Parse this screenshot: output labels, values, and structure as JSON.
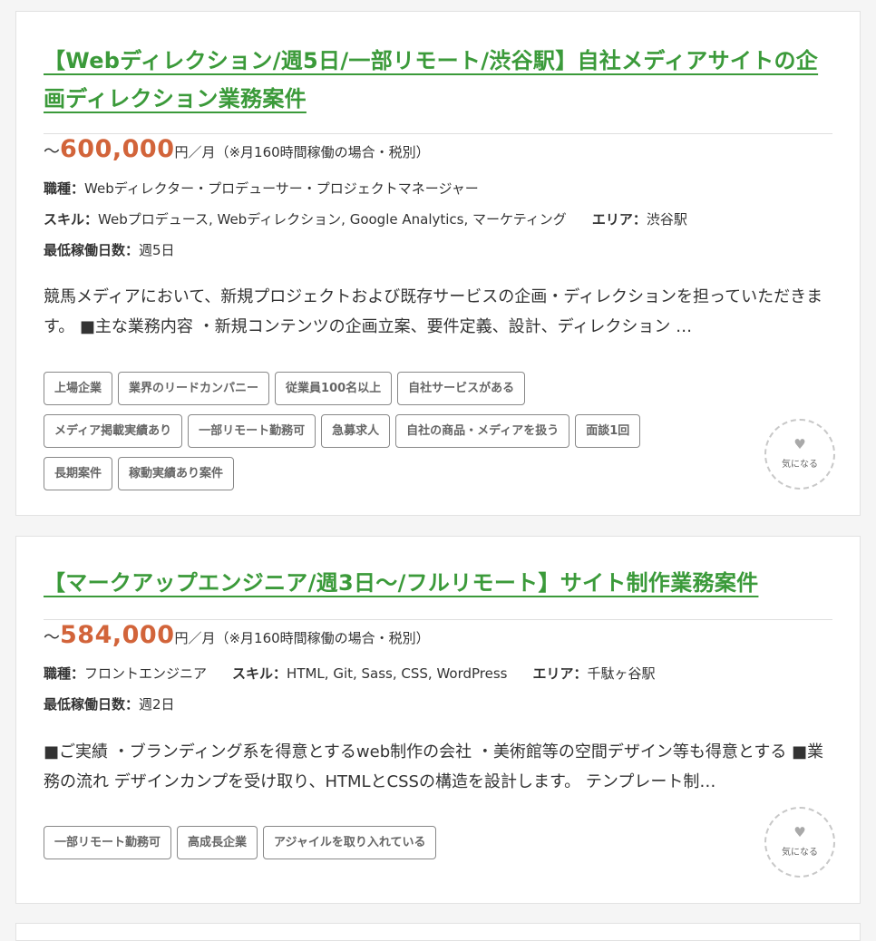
{
  "jobs": [
    {
      "title": "【Webディレクション/週5日/一部リモート/渋谷駅】自社メディアサイトの企画ディレクション業務案件",
      "tilde": "～",
      "price": "600,000",
      "unit": "円／月（※月160時間稼働の場合・税別）",
      "job_type_label": "職種：",
      "job_type": "Webディレクター・プロデューサー・プロジェクトマネージャー",
      "skill_label": "スキル：",
      "skills": "Webプロデュース, Webディレクション, Google Analytics, マーケティング",
      "area_label": "エリア：",
      "area": "渋谷駅",
      "min_days_label": "最低稼働日数：",
      "min_days": "週5日",
      "description": "競馬メディアにおいて、新規プロジェクトおよび既存サービスの企画・ディレクションを担っていただきます。 ■主な業務内容 ・新規コンテンツの企画立案、要件定義、設計、ディレクション …",
      "tags": [
        "上場企業",
        "業界のリードカンパニー",
        "従業員100名以上",
        "自社サービスがある",
        "メディア掲載実績あり",
        "一部リモート勤務可",
        "急募求人",
        "自社の商品・メディアを扱う",
        "面談1回",
        "長期案件",
        "稼動実績あり案件"
      ],
      "favorite_label": "気になる",
      "favorite_icon": "heart-icon"
    },
    {
      "title": "【マークアップエンジニア/週3日〜/フルリモート】サイト制作業務案件",
      "tilde": "～",
      "price": "584,000",
      "unit": "円／月（※月160時間稼働の場合・税別）",
      "job_type_label": "職種：",
      "job_type": "フロントエンジニア",
      "skill_label": "スキル：",
      "skills": "HTML, Git, Sass, CSS, WordPress",
      "area_label": "エリア：",
      "area": "千駄ヶ谷駅",
      "min_days_label": "最低稼働日数：",
      "min_days": "週2日",
      "description": "■ご実績 ・ブランディング系を得意とするweb制作の会社 ・美術館等の空間デザイン等も得意とする ■業務の流れ デザインカンプを受け取り、HTMLとCSSの構造を設計します。 テンプレート制…",
      "tags": [
        "一部リモート勤務可",
        "高成長企業",
        "アジャイルを取り入れている"
      ],
      "favorite_label": "気になる",
      "favorite_icon": "heart-icon"
    }
  ],
  "colors": {
    "title": "#3b9a3a",
    "price": "#d2643a",
    "tag_border": "#888888"
  }
}
